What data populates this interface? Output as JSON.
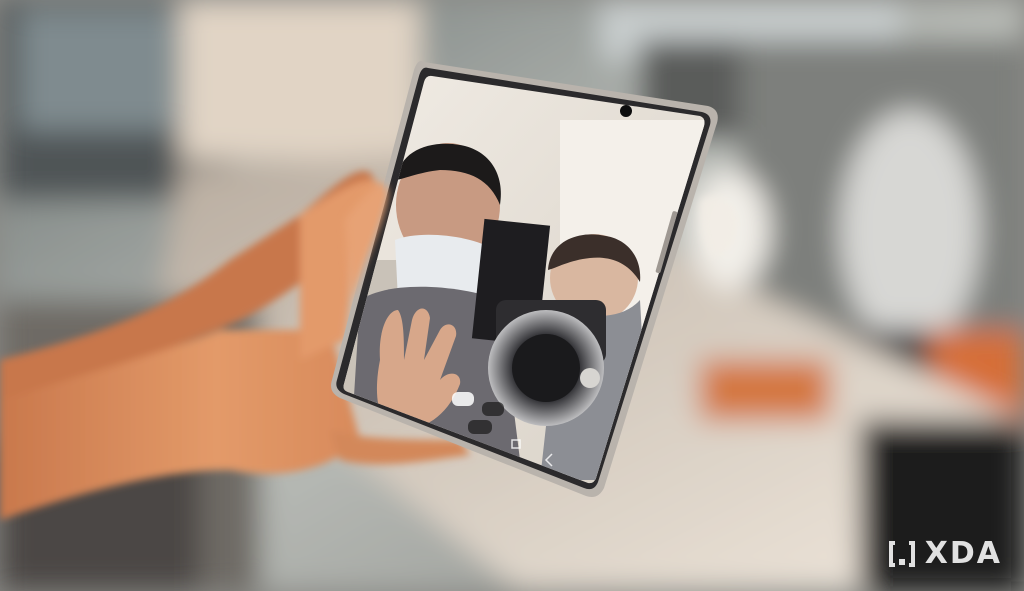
{
  "watermark": {
    "brand": "XDA",
    "icon": "xda-logo-icon"
  },
  "screen": {
    "status_bar": "",
    "camera_buttons": [
      "",
      ""
    ]
  },
  "colors": {
    "background_top": "#9a9e9c",
    "desk": "#d8cfc2",
    "hand": "#d8895a",
    "phone_bezel": "#2b2a2c",
    "phone_frame": "#b9b3ac",
    "screen_bg": "#e9e2d8",
    "accent_orange": "#d8733e"
  }
}
